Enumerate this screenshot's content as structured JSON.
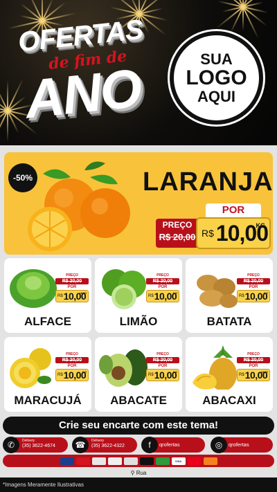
{
  "header": {
    "title_top": "OFERTAS",
    "title_mid": "de fim de",
    "title_bottom": "ANO",
    "logo_line1": "SUA",
    "logo_line2": "LOGO",
    "logo_line3": "AQUI"
  },
  "featured": {
    "discount": "-50%",
    "name": "LARANJA",
    "por_label": "POR",
    "preco_label": "PREÇO",
    "old_price": "R$ 20,00",
    "currency": "R$",
    "new_price": "10,00",
    "unit": "KG"
  },
  "mini_labels": {
    "preco": "PREÇO",
    "old": "R$ 20,00",
    "por": "POR",
    "currency": "R$",
    "price": "10,00"
  },
  "products": [
    {
      "name": "ALFACE",
      "unit": "UNID"
    },
    {
      "name": "LIMÃO",
      "unit": "KG"
    },
    {
      "name": "BATATA",
      "unit": "KG"
    },
    {
      "name": "MARACUJÁ",
      "unit": "KG"
    },
    {
      "name": "ABACATE",
      "unit": "KG"
    },
    {
      "name": "ABACAXI",
      "unit": "UNID"
    }
  ],
  "footer": {
    "cta": "Crie seu encarte com este tema!",
    "delivery_label": "Delivery",
    "phone1": "(35) 3622-4674",
    "phone2": "(35) 3622-4322",
    "facebook": "qrofertas",
    "instagram": "qrofertas",
    "payments": [
      "",
      "",
      "",
      "",
      "",
      "",
      "",
      "VISA",
      "",
      ""
    ],
    "address": "Rua",
    "disclaimer": "*Imagens Meramente Ilustrativas"
  },
  "colors": {
    "accent_red": "#b8101b",
    "hero_yellow": "#f8c33a",
    "tag_gold": "#f9d24a"
  }
}
